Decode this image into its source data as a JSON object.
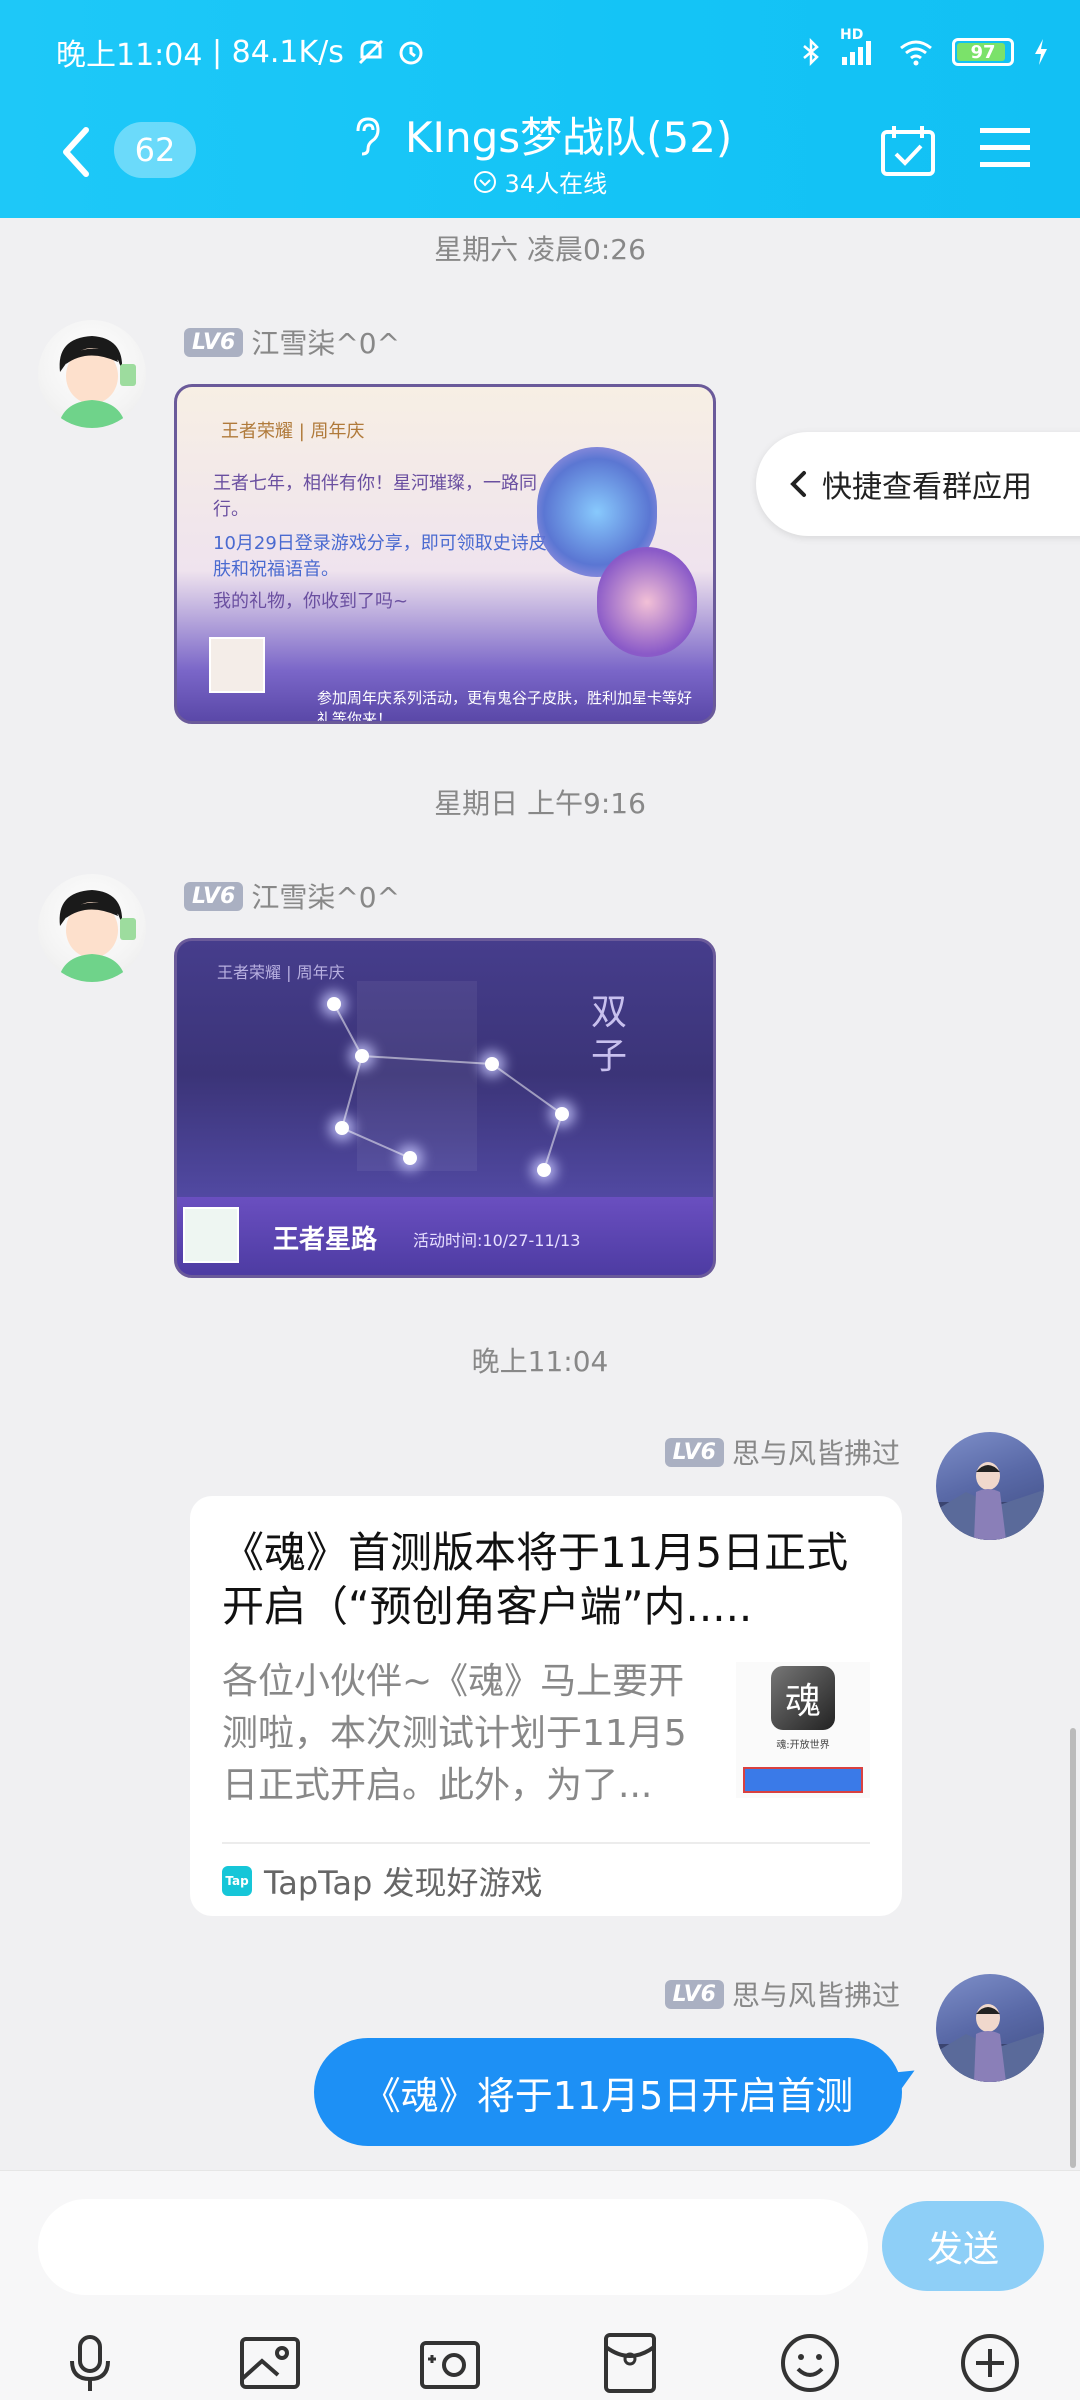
{
  "status": {
    "time": "晚上11:04",
    "speed": "84.1K/s",
    "network": "HD",
    "battery": "97"
  },
  "nav": {
    "unread": "62",
    "title": "KIngs梦战队(52)",
    "online": "34人在线"
  },
  "messages": {
    "ts1": "星期六 凌晨0:26",
    "ts2": "星期日 上午9:16",
    "ts3": "晚上11:04",
    "sender_left": "江雪柒^0^",
    "sender_right": "思与风皆拂过",
    "level": "LV6"
  },
  "image1": {
    "line1": "王者七年，相伴有你！星河璀璨，一路同行。",
    "line2": "10月29日登录游戏分享，即可领取史诗皮肤和祝福语音。",
    "line3": "我的礼物，你收到了吗~",
    "footer": "参加周年庆系列活动，更有鬼谷子皮肤，胜利加星卡等好礼等你来！"
  },
  "image2": {
    "zodiac": "双子",
    "banner": "王者星路",
    "date": "活动时间:10/27-11/13"
  },
  "quick": {
    "label": "快捷查看群应用"
  },
  "card": {
    "title": "《魂》首测版本将于11月5日正式开启（“预创角客户端”内.....",
    "desc": "各位小伙伴~《魂》马上要开测啦，本次测试计划于11月5日正式开启。此外，为了...",
    "thumb_text": "魂:开放世界",
    "source": "TapTap 发现好游戏",
    "source_icon": "Tap"
  },
  "bubble": {
    "text": "《魂》将于11月5日开启首测"
  },
  "input": {
    "placeholder": "",
    "send": "发送"
  },
  "colors": {
    "header": "#14c4f6",
    "bubble": "#1d90f5",
    "send": "#8ecff7"
  }
}
